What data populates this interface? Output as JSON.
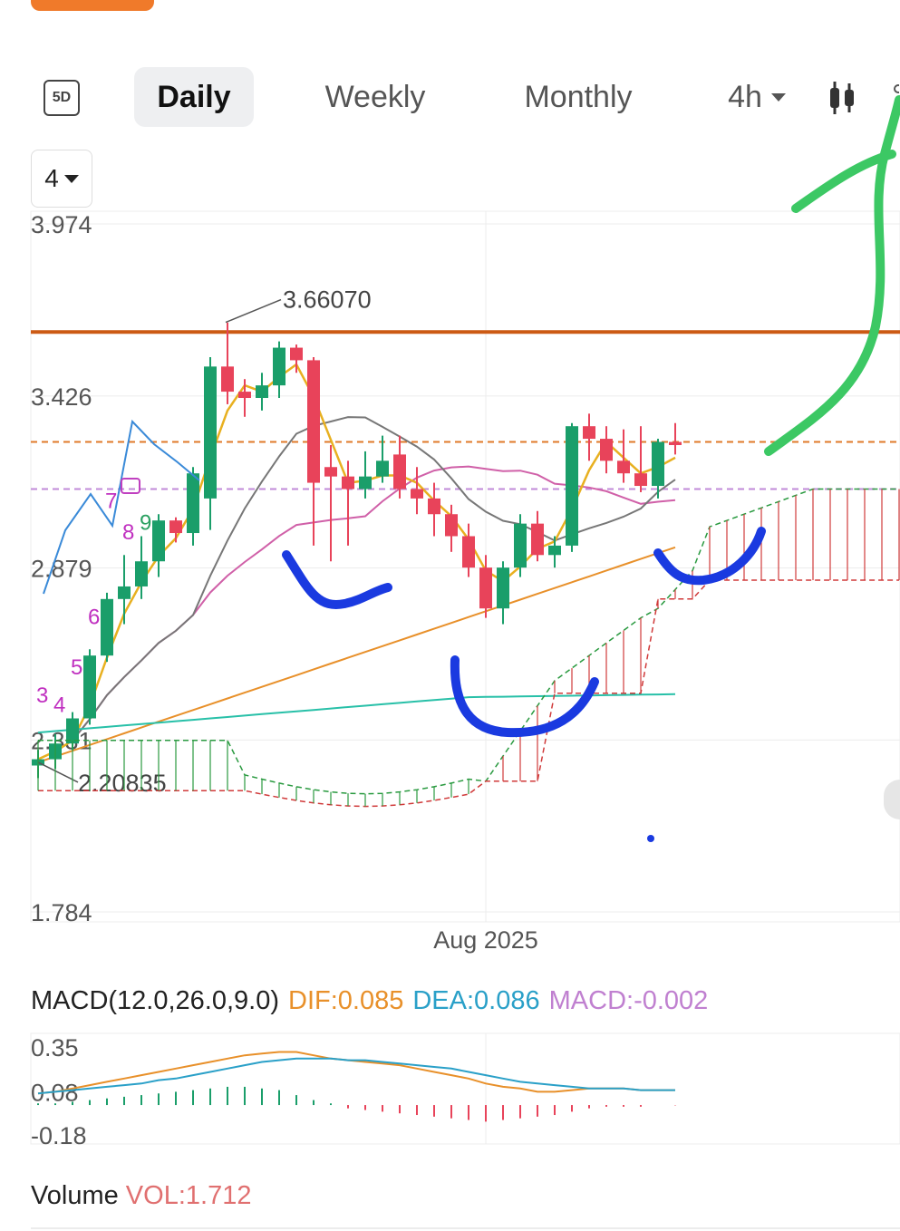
{
  "toolbar": {
    "tabs": [
      {
        "label": "Daily",
        "active": true
      },
      {
        "label": "Weekly",
        "active": false
      },
      {
        "label": "Monthly",
        "active": false
      },
      {
        "label": "4h",
        "active": false
      }
    ],
    "icon_5d": "5D",
    "candle_icon": "candlestick-icon",
    "more_icon": "more-icon"
  },
  "ma_selector": {
    "value": "4"
  },
  "colors": {
    "up": "#1a9e6a",
    "down": "#e8435a",
    "resistance": "#cc5a14",
    "price_line": "#e07a2a",
    "ref_line": "#c08ad8",
    "dif": "#e8902a",
    "dea": "#2aa0c8",
    "macd": "#c080d0",
    "vol": "#e07070",
    "annot_blue": "#1a3ae0",
    "annot_green": "#3cc864"
  },
  "chart_data": {
    "type": "candlestick",
    "y_ticks": [
      "3.974",
      "3.426",
      "2.879",
      "2.331",
      "1.784"
    ],
    "ylim": [
      1.784,
      3.974
    ],
    "x_label": "Aug 2025",
    "x_label_index": 26,
    "high_marker": {
      "label": "3.66070",
      "index": 11,
      "value": 3.6607
    },
    "low_marker": {
      "label": "2.20835",
      "index": 0,
      "value": 2.20835
    },
    "resistance_level": 3.63,
    "price_level": 3.28,
    "ref_level": 3.13,
    "candles": [
      {
        "o": 2.25,
        "h": 2.3,
        "l": 2.21,
        "c": 2.27
      },
      {
        "o": 2.27,
        "h": 2.35,
        "l": 2.24,
        "c": 2.32
      },
      {
        "o": 2.32,
        "h": 2.42,
        "l": 2.3,
        "c": 2.4
      },
      {
        "o": 2.4,
        "h": 2.62,
        "l": 2.38,
        "c": 2.6
      },
      {
        "o": 2.6,
        "h": 2.8,
        "l": 2.58,
        "c": 2.78
      },
      {
        "o": 2.78,
        "h": 2.92,
        "l": 2.7,
        "c": 2.82
      },
      {
        "o": 2.82,
        "h": 2.98,
        "l": 2.78,
        "c": 2.9
      },
      {
        "o": 2.9,
        "h": 3.05,
        "l": 2.85,
        "c": 3.03
      },
      {
        "o": 3.03,
        "h": 3.04,
        "l": 2.96,
        "c": 2.99
      },
      {
        "o": 2.99,
        "h": 3.2,
        "l": 2.95,
        "c": 3.18
      },
      {
        "o": 3.1,
        "h": 3.55,
        "l": 3.0,
        "c": 3.52
      },
      {
        "o": 3.52,
        "h": 3.66,
        "l": 3.4,
        "c": 3.44
      },
      {
        "o": 3.44,
        "h": 3.48,
        "l": 3.36,
        "c": 3.42
      },
      {
        "o": 3.42,
        "h": 3.5,
        "l": 3.38,
        "c": 3.46
      },
      {
        "o": 3.46,
        "h": 3.6,
        "l": 3.42,
        "c": 3.58
      },
      {
        "o": 3.58,
        "h": 3.59,
        "l": 3.5,
        "c": 3.54
      },
      {
        "o": 3.54,
        "h": 3.55,
        "l": 2.95,
        "c": 3.15
      },
      {
        "o": 3.2,
        "h": 3.27,
        "l": 2.9,
        "c": 3.17
      },
      {
        "o": 3.17,
        "h": 3.22,
        "l": 2.95,
        "c": 3.13
      },
      {
        "o": 3.13,
        "h": 3.25,
        "l": 3.1,
        "c": 3.17
      },
      {
        "o": 3.17,
        "h": 3.3,
        "l": 3.15,
        "c": 3.22
      },
      {
        "o": 3.24,
        "h": 3.3,
        "l": 3.1,
        "c": 3.13
      },
      {
        "o": 3.13,
        "h": 3.2,
        "l": 3.05,
        "c": 3.1
      },
      {
        "o": 3.1,
        "h": 3.15,
        "l": 2.98,
        "c": 3.05
      },
      {
        "o": 3.05,
        "h": 3.08,
        "l": 2.93,
        "c": 2.98
      },
      {
        "o": 2.98,
        "h": 3.02,
        "l": 2.85,
        "c": 2.88
      },
      {
        "o": 2.88,
        "h": 2.92,
        "l": 2.72,
        "c": 2.75
      },
      {
        "o": 2.75,
        "h": 2.9,
        "l": 2.7,
        "c": 2.88
      },
      {
        "o": 2.88,
        "h": 3.05,
        "l": 2.85,
        "c": 3.02
      },
      {
        "o": 3.02,
        "h": 3.06,
        "l": 2.9,
        "c": 2.92
      },
      {
        "o": 2.92,
        "h": 2.98,
        "l": 2.88,
        "c": 2.95
      },
      {
        "o": 2.95,
        "h": 3.34,
        "l": 2.93,
        "c": 3.33
      },
      {
        "o": 3.33,
        "h": 3.37,
        "l": 3.22,
        "c": 3.29
      },
      {
        "o": 3.29,
        "h": 3.33,
        "l": 3.18,
        "c": 3.22
      },
      {
        "o": 3.22,
        "h": 3.32,
        "l": 3.15,
        "c": 3.18
      },
      {
        "o": 3.18,
        "h": 3.33,
        "l": 3.12,
        "c": 3.14
      },
      {
        "o": 3.14,
        "h": 3.29,
        "l": 3.1,
        "c": 3.28
      },
      {
        "o": 3.28,
        "h": 3.34,
        "l": 3.24,
        "c": 3.27
      }
    ],
    "td_labels": [
      {
        "text": "3",
        "index": 0,
        "value": 2.45
      },
      {
        "text": "4",
        "index": 1,
        "value": 2.42
      },
      {
        "text": "5",
        "index": 2,
        "value": 2.54
      },
      {
        "text": "6",
        "index": 3,
        "value": 2.7
      },
      {
        "text": "7",
        "index": 4,
        "value": 3.07
      },
      {
        "text": "8",
        "index": 5,
        "value": 2.97
      },
      {
        "text": "9",
        "index": 6,
        "value": 3.0
      }
    ],
    "macd": {
      "label": "MACD(12.0,26.0,9.0)",
      "dif_label": "DIF:0.085",
      "dea_label": "DEA:0.086",
      "macd_label": "MACD:-0.002",
      "y_ticks": [
        "0.35",
        "0.08",
        "-0.18"
      ],
      "ylim": [
        -0.18,
        0.35
      ],
      "dif": [
        0.07,
        0.08,
        0.1,
        0.12,
        0.14,
        0.16,
        0.18,
        0.2,
        0.22,
        0.24,
        0.26,
        0.28,
        0.3,
        0.31,
        0.32,
        0.32,
        0.3,
        0.28,
        0.27,
        0.26,
        0.25,
        0.24,
        0.22,
        0.2,
        0.18,
        0.16,
        0.13,
        0.11,
        0.1,
        0.08,
        0.08,
        0.09,
        0.1,
        0.1,
        0.1,
        0.09,
        0.09,
        0.09
      ],
      "dea": [
        0.07,
        0.08,
        0.09,
        0.1,
        0.11,
        0.12,
        0.13,
        0.15,
        0.16,
        0.18,
        0.2,
        0.22,
        0.24,
        0.26,
        0.27,
        0.28,
        0.28,
        0.28,
        0.27,
        0.27,
        0.26,
        0.25,
        0.24,
        0.23,
        0.22,
        0.2,
        0.18,
        0.16,
        0.14,
        0.13,
        0.12,
        0.11,
        0.1,
        0.1,
        0.1,
        0.09,
        0.09,
        0.09
      ],
      "hist": [
        0.01,
        0.01,
        0.02,
        0.03,
        0.04,
        0.05,
        0.06,
        0.07,
        0.08,
        0.09,
        0.1,
        0.11,
        0.11,
        0.1,
        0.09,
        0.06,
        0.03,
        0.01,
        -0.02,
        -0.03,
        -0.04,
        -0.05,
        -0.06,
        -0.07,
        -0.08,
        -0.09,
        -0.1,
        -0.09,
        -0.08,
        -0.07,
        -0.06,
        -0.04,
        -0.02,
        -0.01,
        -0.01,
        -0.01,
        0.0,
        -0.002
      ]
    },
    "volume": {
      "label": "Volume",
      "vol_label": "VOL:1.712"
    }
  }
}
